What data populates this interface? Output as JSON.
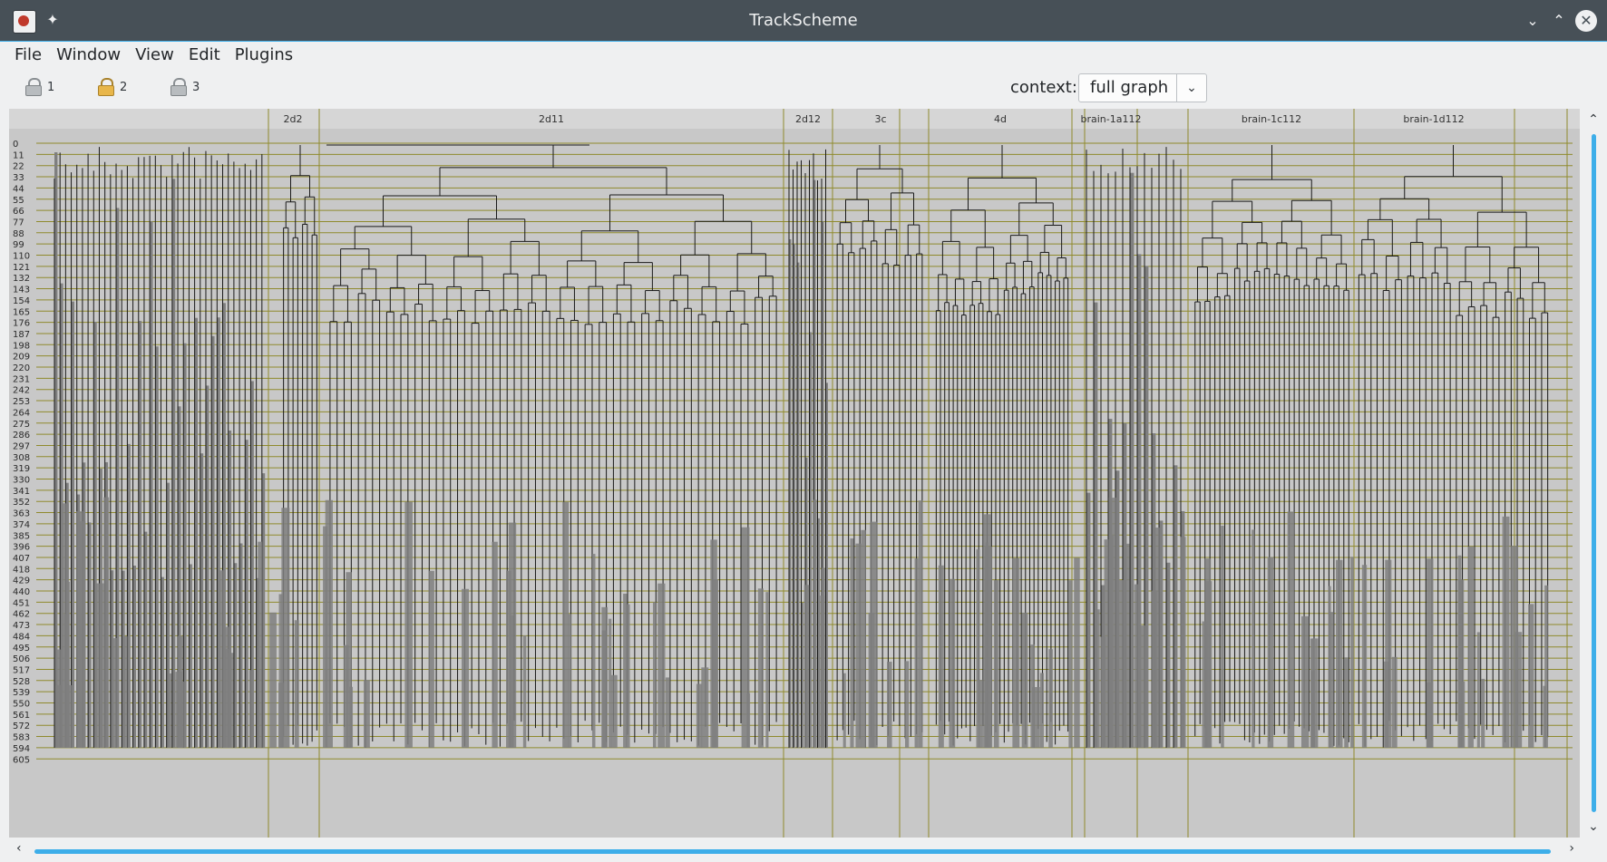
{
  "window": {
    "title": "TrackScheme",
    "app_icon": "fiji-icon",
    "pin_icon": "pin-icon",
    "controls": [
      "minimize-icon",
      "maximize-icon",
      "close-icon"
    ]
  },
  "menu": [
    "File",
    "Window",
    "View",
    "Edit",
    "Plugins"
  ],
  "toolbar": {
    "locks": [
      {
        "label": "1",
        "style": "grey"
      },
      {
        "label": "2",
        "style": "gold"
      },
      {
        "label": "3",
        "style": "grey"
      }
    ],
    "context_label": "context:",
    "context_value": "full graph"
  },
  "graph": {
    "colors": {
      "background": "#c8c8c8",
      "grid": "#8f8a2d",
      "lineage": "#1a1a1a",
      "track_fill": "#7f7f7f",
      "header": "#d6d6d6"
    },
    "row_labels": [
      "0",
      "11",
      "22",
      "33",
      "44",
      "55",
      "66",
      "77",
      "88",
      "99",
      "110",
      "121",
      "132",
      "143",
      "154",
      "165",
      "176",
      "187",
      "198",
      "209",
      "220",
      "231",
      "242",
      "253",
      "264",
      "275",
      "286",
      "297",
      "308",
      "319",
      "330",
      "341",
      "352",
      "363",
      "374",
      "385",
      "396",
      "407",
      "418",
      "429",
      "440",
      "451",
      "462",
      "473",
      "484",
      "495",
      "506",
      "517",
      "528",
      "539",
      "550",
      "561",
      "572",
      "583",
      "594",
      "605"
    ],
    "columns": [
      "2d2",
      "2d11",
      "2d12",
      "3c",
      "4d",
      "brain-1a112",
      "brain-1c112",
      "brain-1d112"
    ]
  }
}
